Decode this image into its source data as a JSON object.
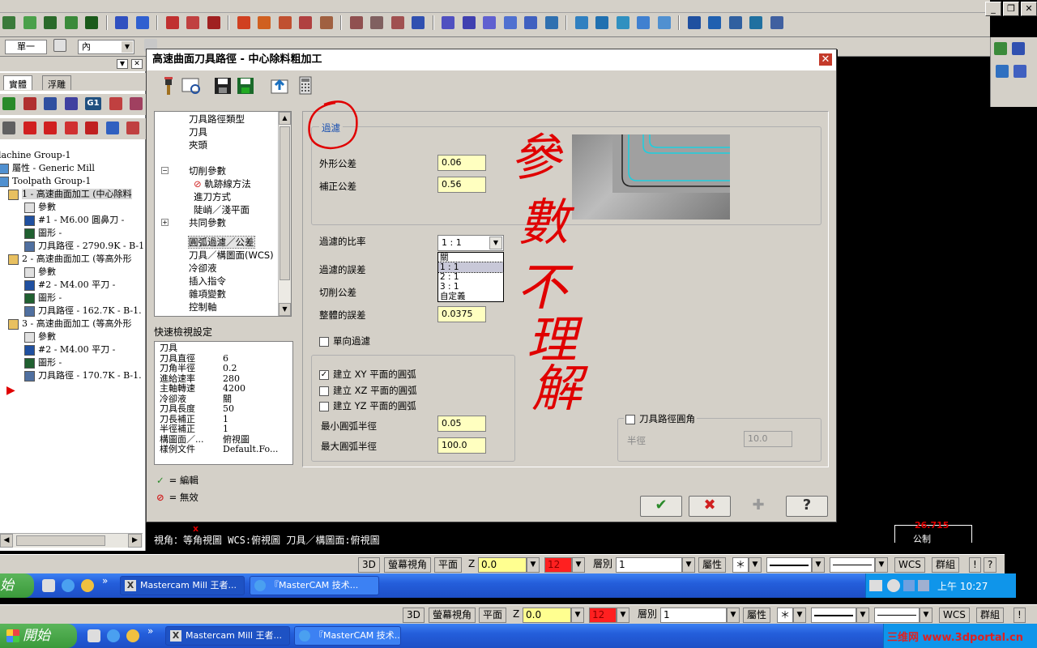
{
  "top_toolbar": {
    "view_mode": "單一",
    "entity_select": "內"
  },
  "left_panel": {
    "tabs": [
      "實體",
      "浮雕"
    ],
    "tree": [
      {
        "text": "lachine Group-1",
        "level": 0
      },
      {
        "text": "屬性 - Generic Mill",
        "level": 1
      },
      {
        "text": "Toolpath Group-1",
        "level": 1
      },
      {
        "text": "1 - 高速曲面加工 (中心除料",
        "level": 2,
        "selected": true
      },
      {
        "text": "參數",
        "level": 3
      },
      {
        "text": "#1 - M6.00 圓鼻刀 -",
        "level": 3
      },
      {
        "text": "圖形 -",
        "level": 3
      },
      {
        "text": "刀具路徑 - 2790.9K - B-1",
        "level": 3
      },
      {
        "text": "2 - 高速曲面加工 (等高外形",
        "level": 2
      },
      {
        "text": "參數",
        "level": 3
      },
      {
        "text": "#2 - M4.00 平刀 -",
        "level": 3
      },
      {
        "text": "圖形 -",
        "level": 3
      },
      {
        "text": "刀具路徑 - 162.7K - B-1.",
        "level": 3
      },
      {
        "text": "3 - 高速曲面加工 (等高外形",
        "level": 2
      },
      {
        "text": "參數",
        "level": 3
      },
      {
        "text": "#2 - M4.00 平刀 -",
        "level": 3
      },
      {
        "text": "圖形 -",
        "level": 3
      },
      {
        "text": "刀具路徑 - 170.7K - B-1.",
        "level": 3
      }
    ]
  },
  "dialog": {
    "title": "高速曲面刀具路徑 - 中心除料粗加工",
    "nav": [
      {
        "label": "刀具路徑類型",
        "indent": 1
      },
      {
        "label": "刀具",
        "indent": 1
      },
      {
        "label": "夾頭",
        "indent": 1
      },
      {
        "label": "切削參數",
        "indent": 1,
        "expander": "-"
      },
      {
        "label": "軌跡線方法",
        "indent": 2,
        "icon": "invalid"
      },
      {
        "label": "進刀方式",
        "indent": 2
      },
      {
        "label": "陡峭／淺平面",
        "indent": 2
      },
      {
        "label": "共同參數",
        "indent": 1,
        "expander": "+"
      },
      {
        "label": "圓弧過濾／公差",
        "indent": 1,
        "selected": true
      },
      {
        "label": "刀具／構圖面(WCS)",
        "indent": 1
      },
      {
        "label": "冷卻液",
        "indent": 1
      },
      {
        "label": "插入指令",
        "indent": 1
      },
      {
        "label": "雜項變數",
        "indent": 1
      },
      {
        "label": "控制軸",
        "indent": 1
      }
    ],
    "quick_view": {
      "title": "快速檢視設定",
      "rows": [
        {
          "k": "刀具",
          "v": ""
        },
        {
          "k": "刀具直徑",
          "v": "6"
        },
        {
          "k": "刀角半徑",
          "v": "0.2"
        },
        {
          "k": "進給速率",
          "v": "280"
        },
        {
          "k": "主軸轉速",
          "v": "4200"
        },
        {
          "k": "冷卻液",
          "v": "關"
        },
        {
          "k": "刀具長度",
          "v": "50"
        },
        {
          "k": "刀長補正",
          "v": "1"
        },
        {
          "k": "半徑補正",
          "v": "1"
        },
        {
          "k": "構圖面／...",
          "v": "俯視圖"
        },
        {
          "k": "樣例文件",
          "v": "Default.Fo..."
        }
      ]
    },
    "legend": {
      "edit": "= 編輯",
      "invalid": "= 無效"
    },
    "filter_group": {
      "title": "過濾",
      "outer_tolerance_label": "外形公差",
      "outer_tolerance": "0.06",
      "comp_tolerance_label": "補正公差",
      "comp_tolerance": "0.56"
    },
    "filter_ratio_label": "過濾的比率",
    "filter_ratio_selected": "1 : 1",
    "filter_ratio_options": [
      "關",
      "1 : 1",
      "2 : 1",
      "3 : 1",
      "自定義"
    ],
    "filter_error_label": "過濾的誤差",
    "cut_tolerance_label": "切削公差",
    "total_error_label": "整體的誤差",
    "total_error": "0.0375",
    "one_way_filter_label": "單向過濾",
    "arc_group": {
      "xy_label": "建立 XY 平面的圓弧",
      "xy_checked": true,
      "xz_label": "建立 XZ 平面的圓弧",
      "xz_checked": false,
      "yz_label": "建立 YZ 平面的圓弧",
      "yz_checked": false,
      "min_radius_label": "最小圓弧半徑",
      "min_radius": "0.05",
      "max_radius_label": "最大圓弧半徑",
      "max_radius": "100.0"
    },
    "fillet_group": {
      "title": "刀具路徑圓角",
      "radius_label": "半徑",
      "radius": "10.0"
    },
    "annotation_text": [
      "參",
      "數",
      "不",
      "理",
      "解"
    ]
  },
  "viewport_status": "視角：等角視圖   WCS:俯視圖   刀具／構圖面:俯視圖",
  "scale": {
    "value": "26.715",
    "unit": "公制"
  },
  "statusbar": {
    "btn_3d": "3D",
    "screen_view": "螢幕視角",
    "plane": "平面",
    "z_label": "Z",
    "z_value": "0.0",
    "color_value": "12",
    "level_label": "層別",
    "level_value": "1",
    "attributes": "屬性",
    "wcs": "WCS",
    "group": "群組"
  },
  "taskbar": {
    "start": "開始",
    "start_partial": "始",
    "tasks": [
      "Mastercam Mill 王者...",
      "『MasterCAM 技术..."
    ],
    "clock": "上午 10:27",
    "watermark": "三维网 www.3dportal.cn"
  },
  "colors": {
    "red_annotation": "#e00000",
    "field_yellow": "#ffffc0",
    "panel_gray": "#d4d0c8",
    "xp_blue": "#245edb"
  }
}
